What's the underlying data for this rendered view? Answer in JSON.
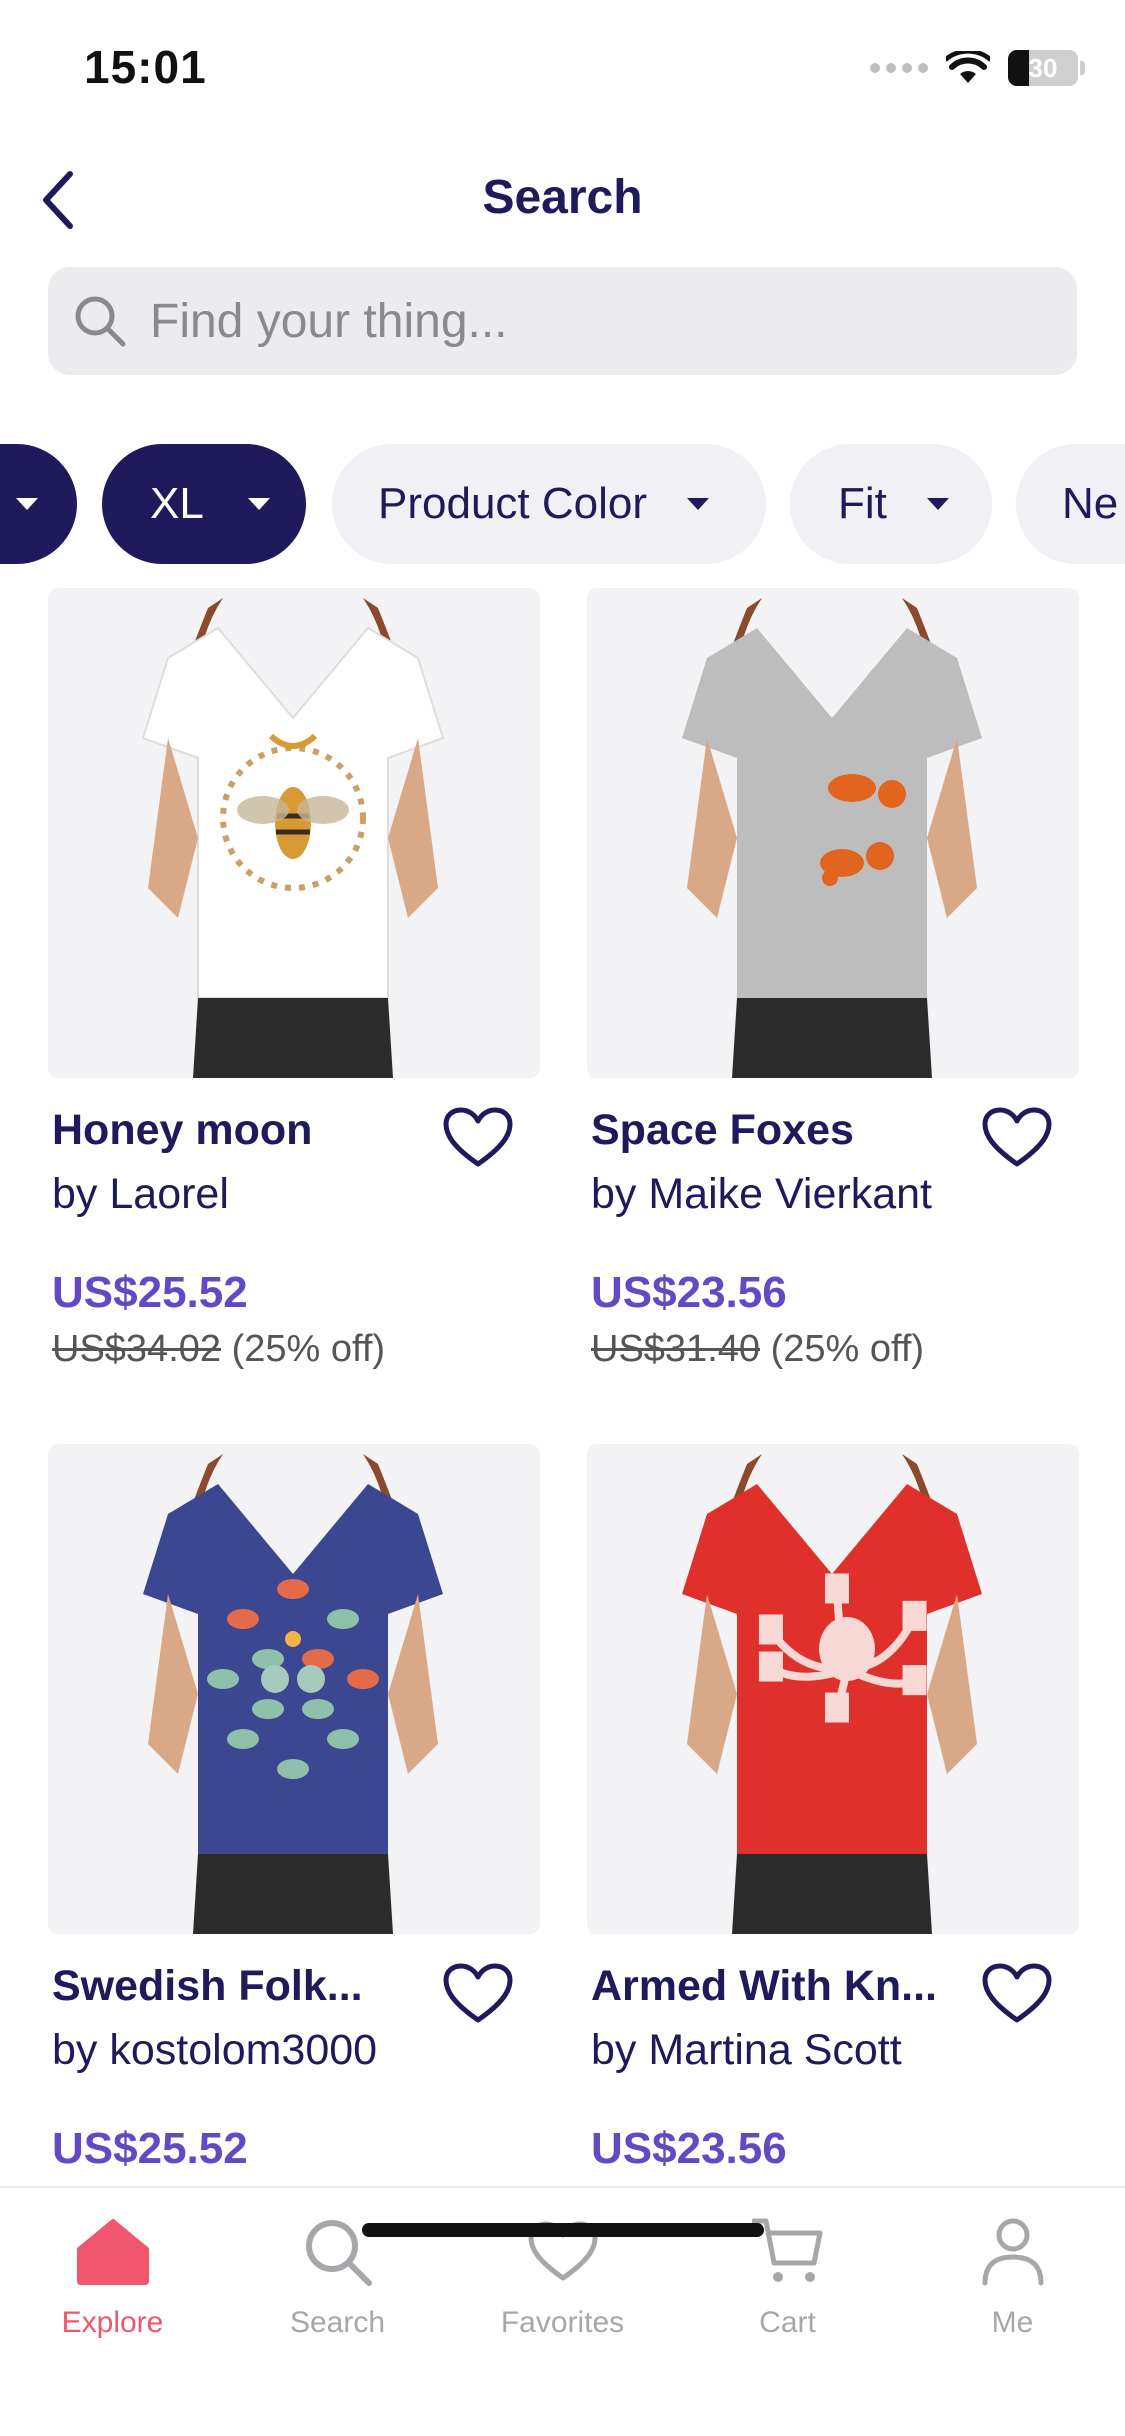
{
  "status": {
    "time": "15:01",
    "battery": "30",
    "battery_level": 0.3
  },
  "header": {
    "title": "Search"
  },
  "search": {
    "placeholder": "Find your thing..."
  },
  "filters": [
    {
      "label": "",
      "selected": true
    },
    {
      "label": "XL",
      "selected": true
    },
    {
      "label": "Product Color",
      "selected": false
    },
    {
      "label": "Fit",
      "selected": false
    },
    {
      "label": "Ne",
      "selected": false
    }
  ],
  "products": [
    {
      "title": "Honey moon",
      "artist": "by Laorel",
      "price": "US$25.52",
      "old_price": "US$34.02",
      "discount": "(25% off)",
      "shirt_color": "#ffffff",
      "design": "bee"
    },
    {
      "title": "Space Foxes",
      "artist": "by Maike Vierkant",
      "price": "US$23.56",
      "old_price": "US$31.40",
      "discount": "(25% off)",
      "shirt_color": "#bdbdbd",
      "design": "foxes"
    },
    {
      "title": "Swedish Folk...",
      "artist": "by kostolom3000",
      "price": "US$25.52",
      "old_price": "",
      "discount": "",
      "shirt_color": "#3c4791",
      "design": "folk"
    },
    {
      "title": "Armed With Kn...",
      "artist": "by Martina Scott",
      "price": "US$23.56",
      "old_price": "",
      "discount": "",
      "shirt_color": "#e0302b",
      "design": "octopus"
    }
  ],
  "tabs": [
    {
      "label": "Explore",
      "icon": "home-icon",
      "active": true
    },
    {
      "label": "Search",
      "icon": "search-icon",
      "active": false
    },
    {
      "label": "Favorites",
      "icon": "heart-icon",
      "active": false
    },
    {
      "label": "Cart",
      "icon": "cart-icon",
      "active": false
    },
    {
      "label": "Me",
      "icon": "person-icon",
      "active": false
    }
  ],
  "colors": {
    "brand_dark": "#1f1a5c",
    "price": "#6449c4",
    "active_tab": "#f0566e",
    "inactive_tab": "#a7a7ab",
    "chip_light": "#f0f0f5"
  }
}
